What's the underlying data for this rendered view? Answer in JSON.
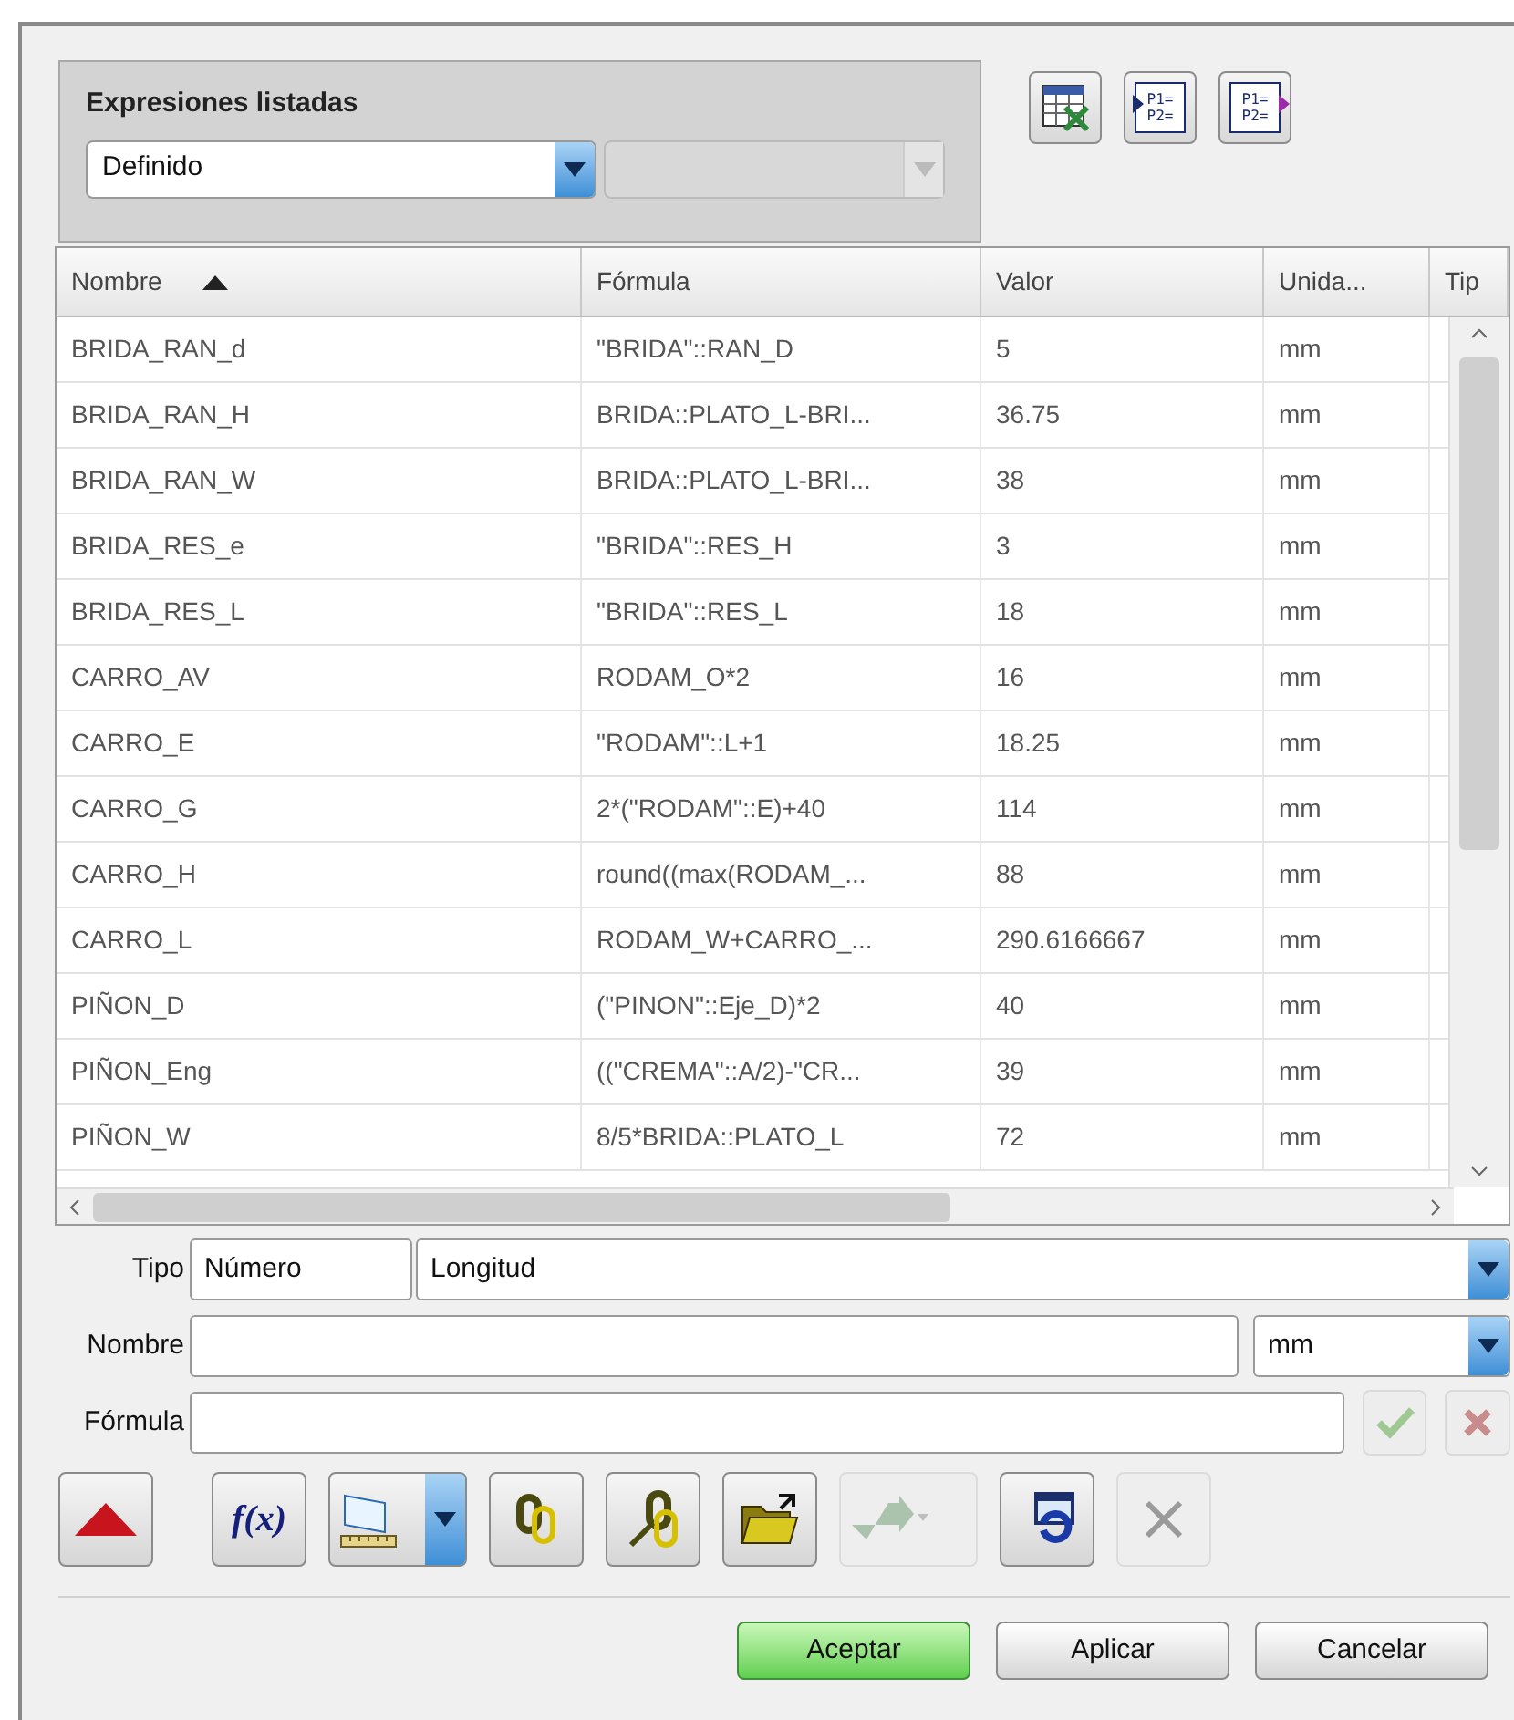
{
  "filter": {
    "title": "Expresiones listadas",
    "value": "Definido",
    "second_disabled": true
  },
  "top_tools": [
    {
      "kind": "spreadsheet"
    },
    {
      "kind": "import",
      "lines": [
        "P1=",
        "P2="
      ]
    },
    {
      "kind": "export",
      "lines": [
        "P1=",
        "P2="
      ]
    }
  ],
  "table": {
    "columns": [
      {
        "label": "Nombre",
        "sorted": true
      },
      {
        "label": "Fórmula",
        "sorted": false
      },
      {
        "label": "Valor",
        "sorted": false
      },
      {
        "label": "Unida...",
        "sorted": false
      },
      {
        "label": "Tip",
        "sorted": false
      }
    ],
    "rows": [
      [
        "BRIDA_RAN_d",
        "\"BRIDA\"::RAN_D",
        "5",
        "mm"
      ],
      [
        "BRIDA_RAN_H",
        "BRIDA::PLATO_L-BRI...",
        "36.75",
        "mm"
      ],
      [
        "BRIDA_RAN_W",
        "BRIDA::PLATO_L-BRI...",
        "38",
        "mm"
      ],
      [
        "BRIDA_RES_e",
        "\"BRIDA\"::RES_H",
        "3",
        "mm"
      ],
      [
        "BRIDA_RES_L",
        "\"BRIDA\"::RES_L",
        "18",
        "mm"
      ],
      [
        "CARRO_AV",
        "RODAM_O*2",
        "16",
        "mm"
      ],
      [
        "CARRO_E",
        "\"RODAM\"::L+1",
        "18.25",
        "mm"
      ],
      [
        "CARRO_G",
        "2*(\"RODAM\"::E)+40",
        "114",
        "mm"
      ],
      [
        "CARRO_H",
        "round((max(RODAM_...",
        "88",
        "mm"
      ],
      [
        "CARRO_L",
        "RODAM_W+CARRO_...",
        "290.6166667",
        "mm"
      ],
      [
        "PIÑON_D",
        "(\"PINON\"::Eje_D)*2",
        "40",
        "mm"
      ],
      [
        "PIÑON_Eng",
        "((\"CREMA\"::A/2)-\"CR...",
        "39",
        "mm"
      ],
      [
        "PIÑON_W",
        "8/5*BRIDA::PLATO_L",
        "72",
        "mm"
      ]
    ]
  },
  "tipo": {
    "label": "Tipo",
    "type": "Número",
    "dimension": "Longitud"
  },
  "nombre": {
    "label": "Nombre",
    "unit": "mm"
  },
  "formula": {
    "label": "Fórmula",
    "accept_disabled": true,
    "reject_disabled": true
  },
  "tools": [
    {
      "kind": "triangle",
      "disabled": false
    },
    {
      "kind": "function",
      "text": "f(x)",
      "disabled": false
    },
    {
      "kind": "measure",
      "disabled": false
    },
    {
      "kind": "link",
      "disabled": false
    },
    {
      "kind": "unlink",
      "disabled": false
    },
    {
      "kind": "folder",
      "disabled": false
    },
    {
      "kind": "arrow",
      "disabled": true
    },
    {
      "kind": "refresh",
      "disabled": false
    },
    {
      "kind": "delete",
      "disabled": true
    }
  ],
  "buttons": [
    {
      "label": "Aceptar",
      "default": true
    },
    {
      "label": "Aplicar",
      "default": false
    },
    {
      "label": "Cancelar",
      "default": false
    }
  ]
}
